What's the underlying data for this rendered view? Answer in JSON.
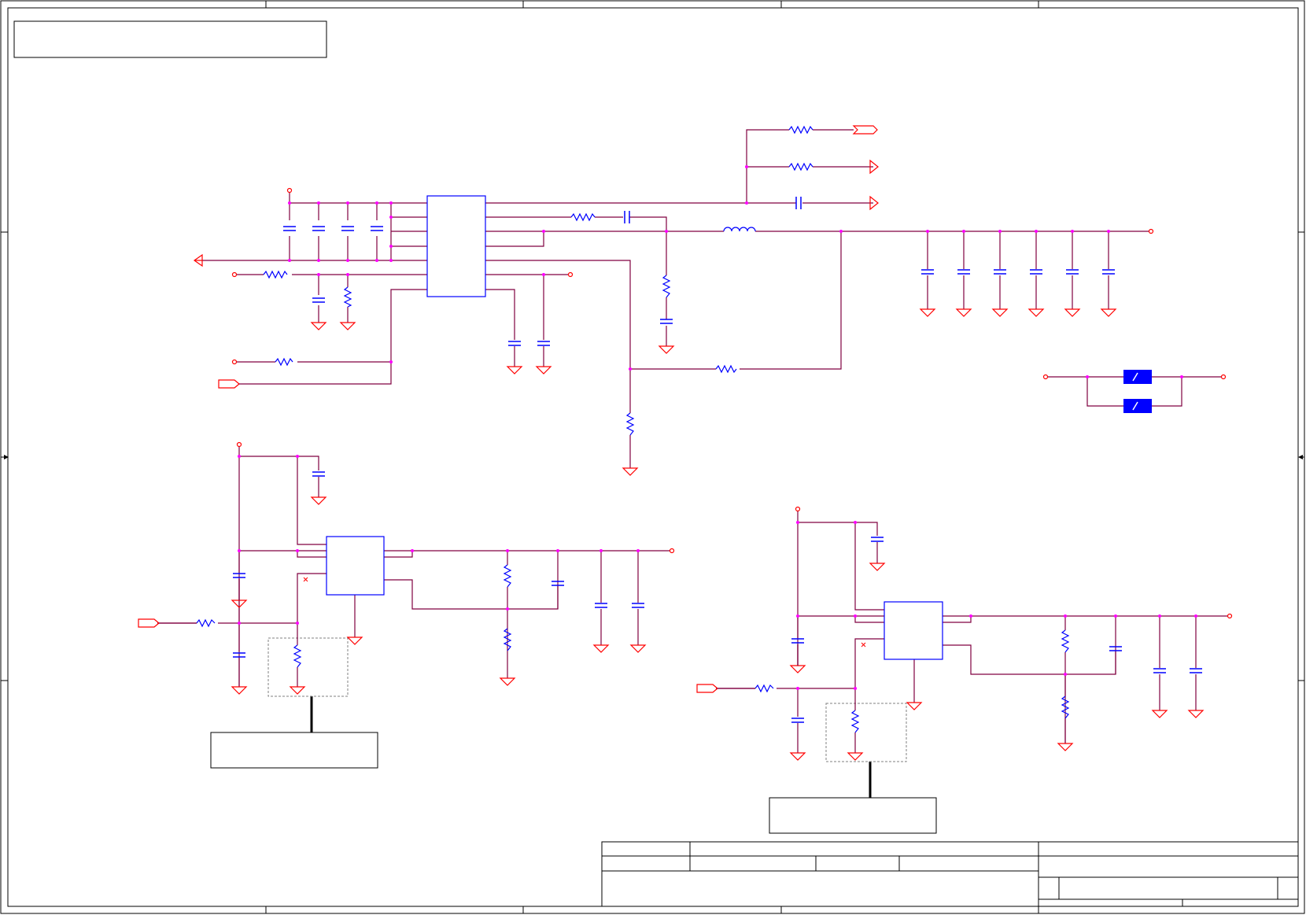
{
  "sheet": {
    "zone_columns": 5,
    "zone_rows": 4,
    "colors": {
      "border": "#000000",
      "wire": "#800040",
      "net_pin": "#ff0000",
      "component": "#0000ff",
      "junction": "#ff00ff",
      "fill_block": "#0000ff",
      "dashed_box": "#808080"
    }
  },
  "notes": {
    "top_left": "",
    "bottom_left": "",
    "bottom_right": ""
  },
  "title_block": {
    "company": "",
    "project": "",
    "title": "",
    "size": "",
    "document_number": "",
    "revision": "",
    "date": "",
    "sheet": ""
  }
}
